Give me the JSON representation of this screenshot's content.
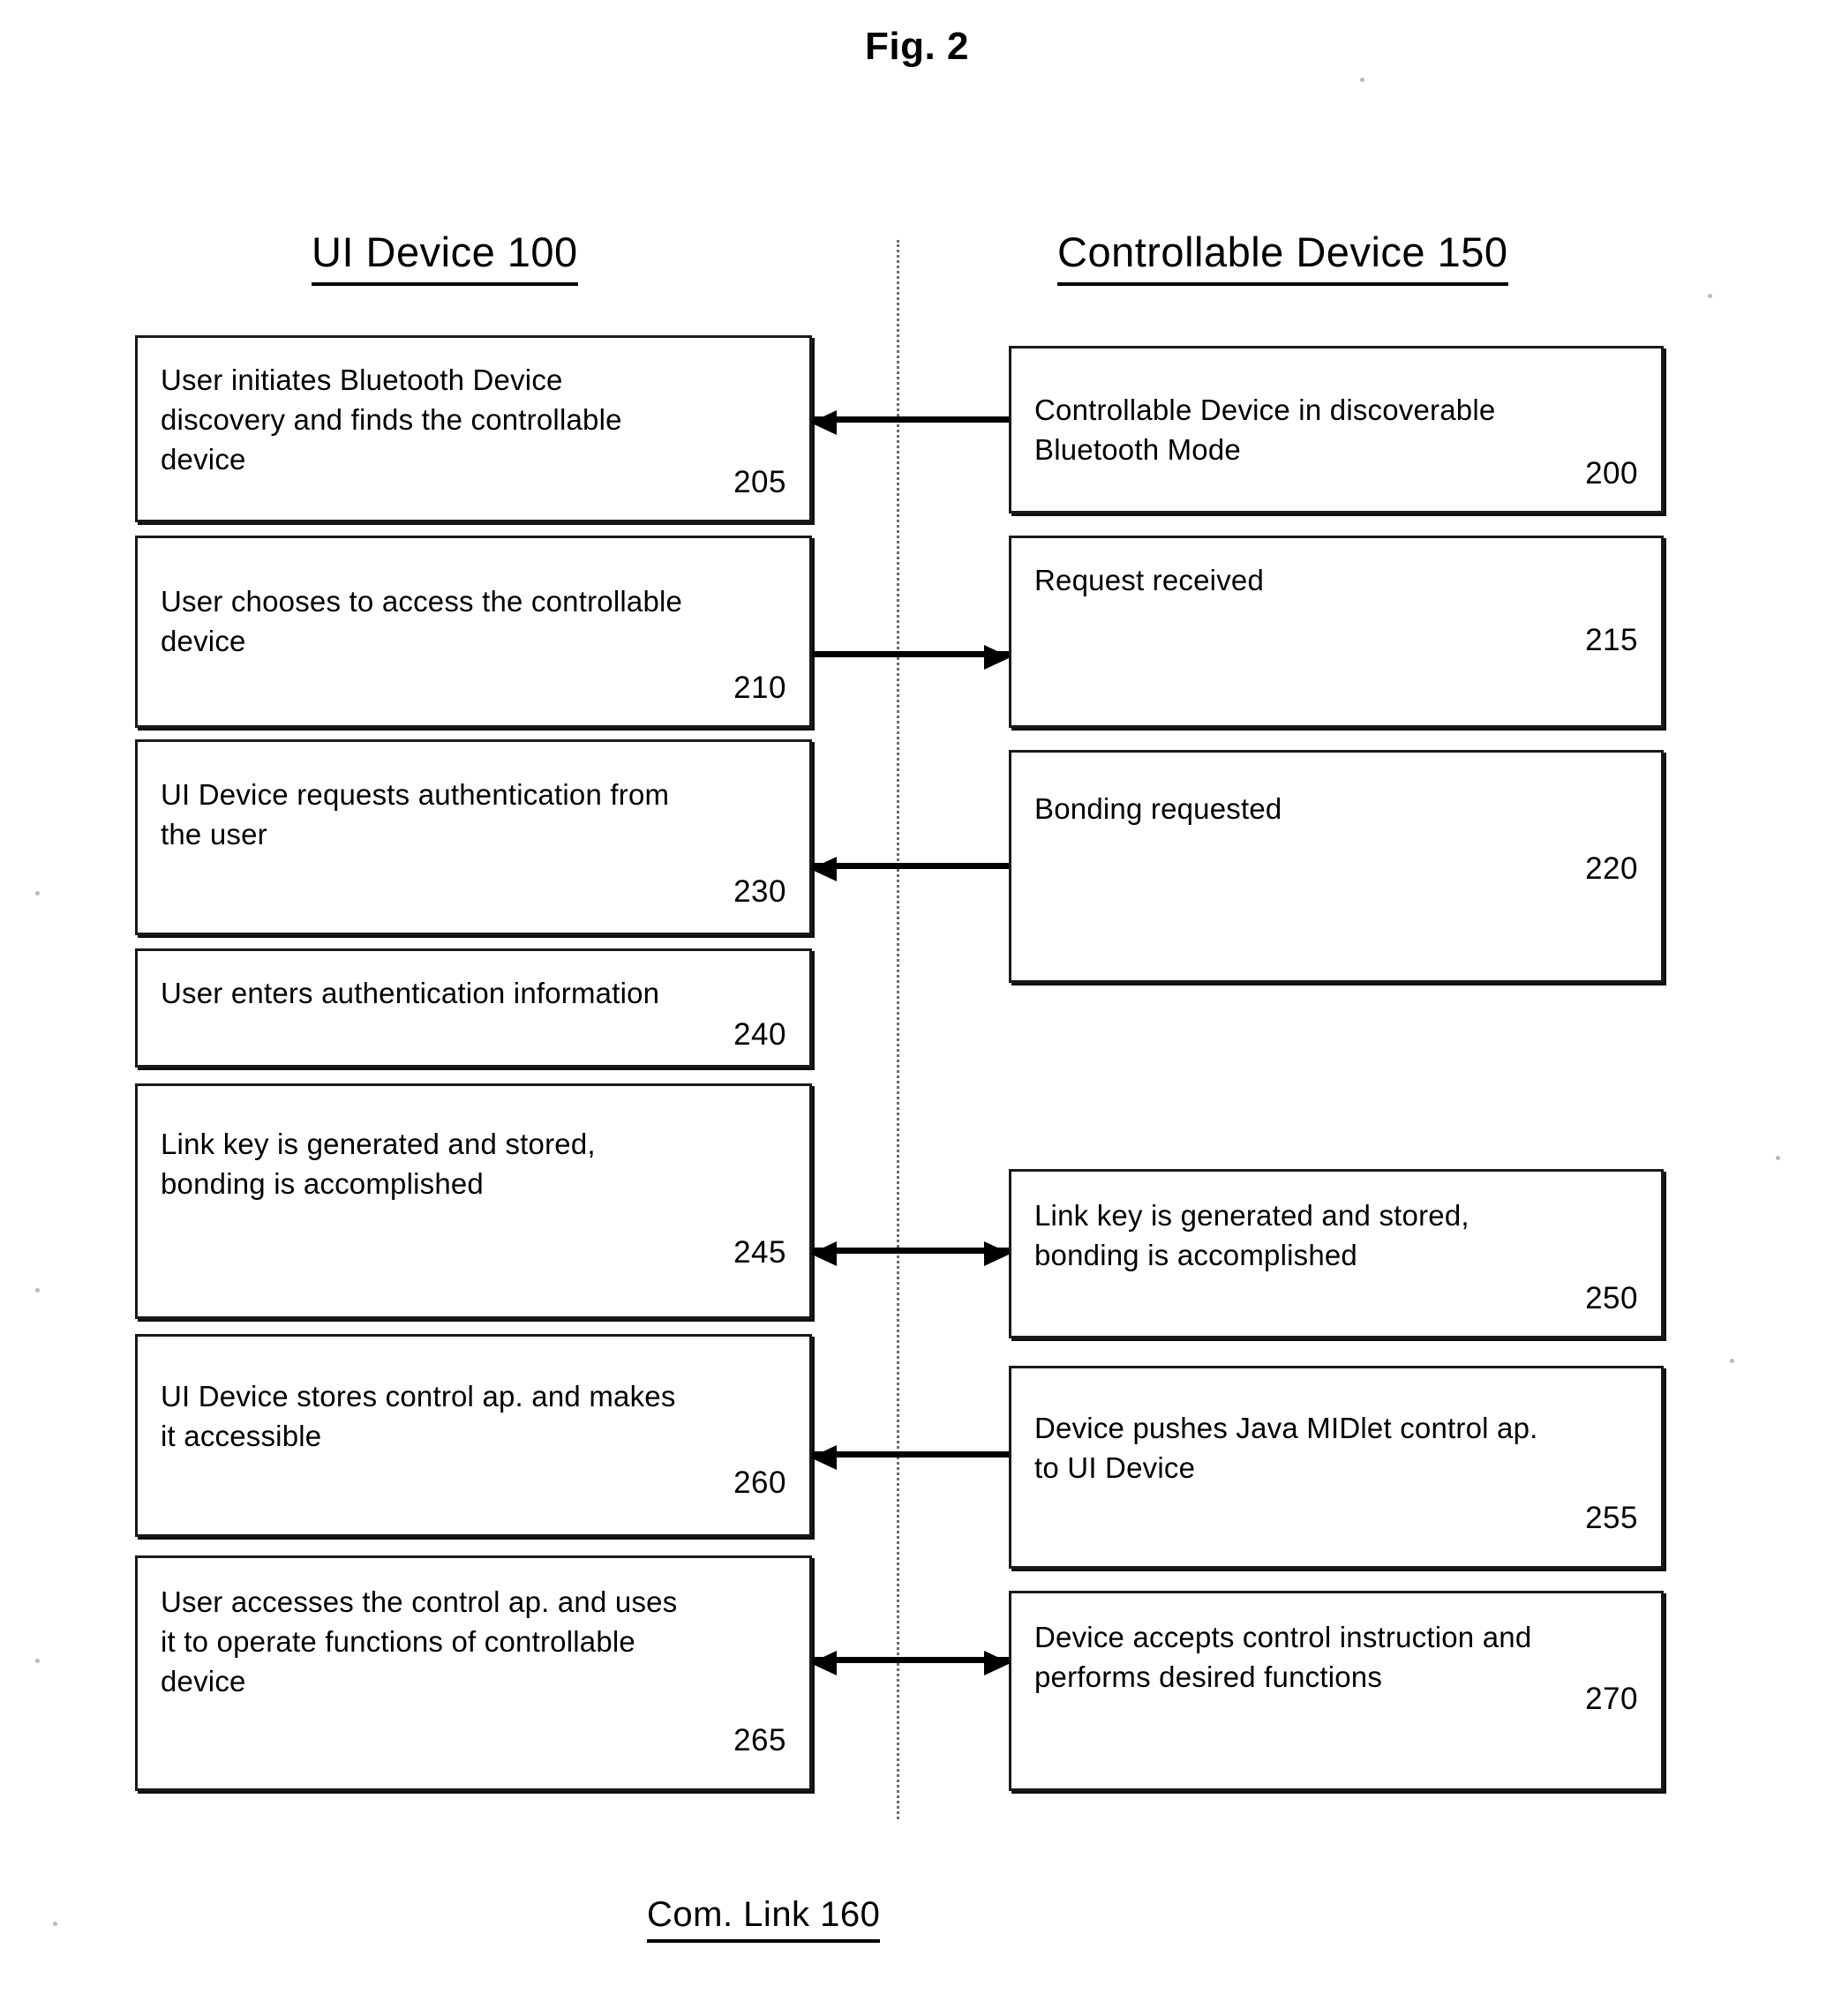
{
  "figure": {
    "title": "Fig. 2",
    "caption": "Com. Link 160"
  },
  "columns": {
    "left_header": "UI Device 100",
    "right_header": "Controllable Device 150"
  },
  "left_boxes": [
    {
      "text": "User initiates Bluetooth Device\ndiscovery and finds the controllable\ndevice",
      "number": "205"
    },
    {
      "text": "User chooses to access the controllable\ndevice",
      "number": "210"
    },
    {
      "text": "UI Device requests authentication from\nthe user",
      "number": "230"
    },
    {
      "text": "User enters authentication information",
      "number": "240"
    },
    {
      "text": "Link key is generated and stored,\nbonding is accomplished",
      "number": "245"
    },
    {
      "text": "UI Device stores control ap. and makes\nit accessible",
      "number": "260"
    },
    {
      "text": "User accesses the control ap. and uses\nit to operate functions of controllable\ndevice",
      "number": "265"
    }
  ],
  "right_boxes": [
    {
      "text": "Controllable Device in discoverable\nBluetooth Mode",
      "number": "200"
    },
    {
      "text": "Request received",
      "number": "215"
    },
    {
      "text": "Bonding requested",
      "number": "220"
    },
    {
      "text": "Link key is generated and stored,\nbonding is accomplished",
      "number": "250"
    },
    {
      "text": "Device pushes Java MIDlet control ap.\nto UI Device",
      "number": "255"
    },
    {
      "text": "Device accepts control instruction and\nperforms desired functions",
      "number": "270"
    }
  ],
  "arrows": [
    {
      "name": "arrow-200-to-205",
      "direction": "left"
    },
    {
      "name": "arrow-210-to-215",
      "direction": "right"
    },
    {
      "name": "arrow-220-to-230",
      "direction": "left"
    },
    {
      "name": "arrow-245-250-bidirectional",
      "direction": "both"
    },
    {
      "name": "arrow-255-to-260",
      "direction": "left"
    },
    {
      "name": "arrow-265-270-bidirectional",
      "direction": "both"
    }
  ],
  "colors": {
    "ink": "#000000",
    "paper": "#ffffff",
    "lifeline": "#6b6b6b"
  }
}
